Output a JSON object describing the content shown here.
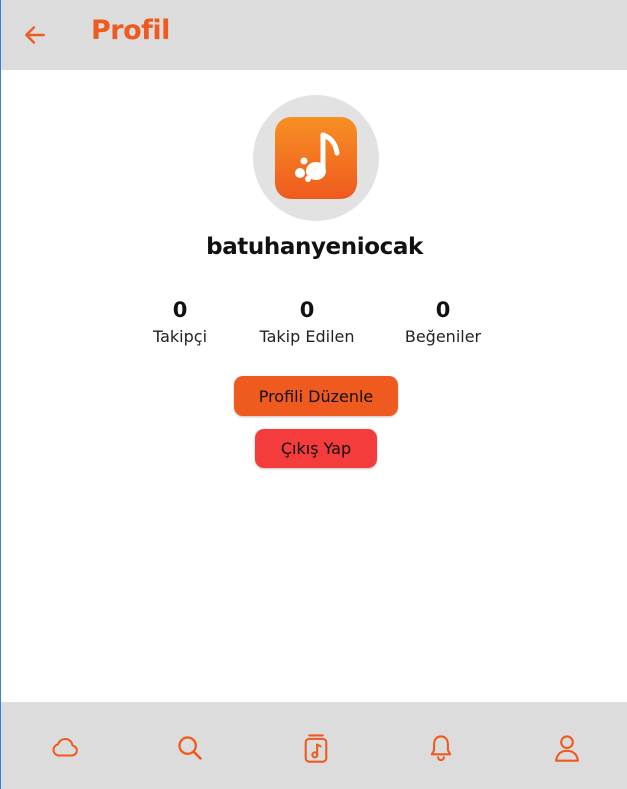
{
  "header": {
    "title": "Profil",
    "back_icon": "arrow-left-icon"
  },
  "colors": {
    "accent": "#ef5a1e",
    "danger": "#f43c3c",
    "bar_background": "#dcdcdc",
    "avatar_background": "#e2e2e2"
  },
  "profile": {
    "avatar_icon": "music-note-app-icon",
    "username": "batuhanyeniocak",
    "stats": [
      {
        "value": "0",
        "label": "Takipçi"
      },
      {
        "value": "0",
        "label": "Takip Edilen"
      },
      {
        "value": "0",
        "label": "Beğeniler"
      }
    ],
    "edit_button_label": "Profili Düzenle",
    "logout_button_label": "Çıkış Yap"
  },
  "bottom_nav": {
    "items": [
      {
        "icon": "cloud-icon"
      },
      {
        "icon": "search-icon"
      },
      {
        "icon": "music-file-icon"
      },
      {
        "icon": "bell-icon"
      },
      {
        "icon": "user-icon"
      }
    ]
  }
}
